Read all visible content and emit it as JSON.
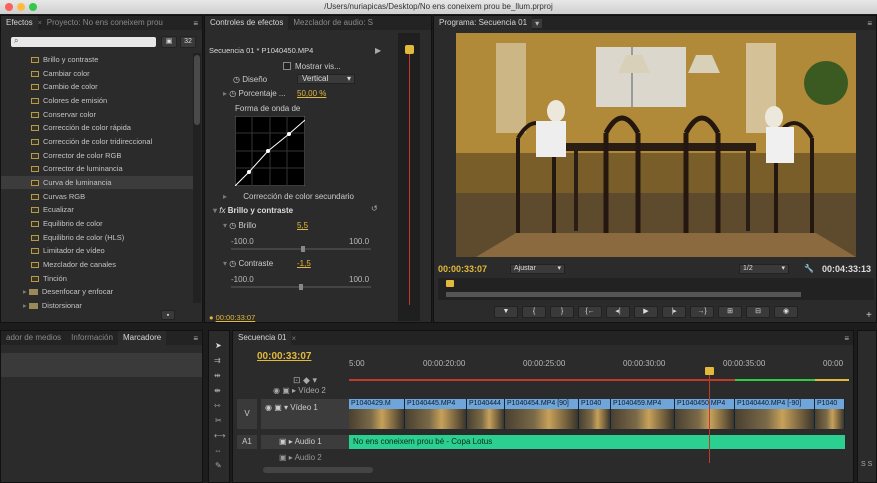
{
  "window": {
    "title": "/Users/nuriapicas/Desktop/No ens coneixem prou be_llum.prproj"
  },
  "effects_panel": {
    "tabs": [
      "Efectos",
      "Proyecto: No ens coneixem prou"
    ],
    "items": [
      "Brillo y contraste",
      "Cambiar color",
      "Cambio de color",
      "Colores de emisión",
      "Conservar color",
      "Corrección de color rápida",
      "Corrección de color tridireccional",
      "Corrector de color RGB",
      "Corrector de luminancia",
      "Curva de luminancia",
      "Curvas RGB",
      "Ecualizar",
      "Equilibrio de color",
      "Equilibrio de color (HLS)",
      "Limitador de vídeo",
      "Mezclador de canales",
      "Tinción"
    ],
    "folders": [
      "Desenfocar y enfocar",
      "Distorsionar"
    ],
    "selected": "Curva de luminancia"
  },
  "effect_controls": {
    "tabs": [
      "Controles de efectos",
      "Mezclador de audio: S"
    ],
    "clip": "Secuencia 01 * P1040450.MP4",
    "mostrar": "Mostrar vis...",
    "diseno_label": "Diseño",
    "diseno_value": "Vertical",
    "porcentaje_label": "Porcentaje ...",
    "porcentaje_value": "50,00 %",
    "forma_label": "Forma de onda de",
    "secundario": "Corrección de color secundario",
    "bc_title": "Brillo y contraste",
    "brillo_label": "Brillo",
    "brillo_value": "5,5",
    "brillo_min": "-100.0",
    "brillo_max": "100.0",
    "contraste_label": "Contraste",
    "contraste_value": "-1,5",
    "contraste_min": "-100.0",
    "contraste_max": "100.0",
    "timecode": "00:00:33:07"
  },
  "program": {
    "tab": "Programa: Secuencia 01",
    "timecode": "00:00:33:07",
    "fit": "Ajustar",
    "resolution": "1/2",
    "duration": "00:04:33:13"
  },
  "project_panel": {
    "tabs": [
      "ador de medios",
      "Información",
      "Marcadore"
    ]
  },
  "timeline": {
    "tab": "Secuencia 01",
    "timecode": "00:00:33:07",
    "ruler": [
      "5:00",
      "00:00:20:00",
      "00:00:25:00",
      "00:00:30:00",
      "00:00:35:00",
      "00:00"
    ],
    "tracks": {
      "v2": "Vídeo 2",
      "v1": "Vídeo 1",
      "a1": "Audio 1",
      "a2": "Audio 2",
      "v": "V",
      "a1_label": "A1"
    },
    "clips": [
      "P1040429.M",
      "P1040445.MP4",
      "P1040444",
      "P1040454.MP4 [90]",
      "P1040",
      "P1040459.MP4",
      "P1040450.MP4",
      "P1040440.MP4 [-90]",
      "P1040"
    ],
    "audio_clip": "No ens coneixem prou bé - Copa Lotus"
  }
}
